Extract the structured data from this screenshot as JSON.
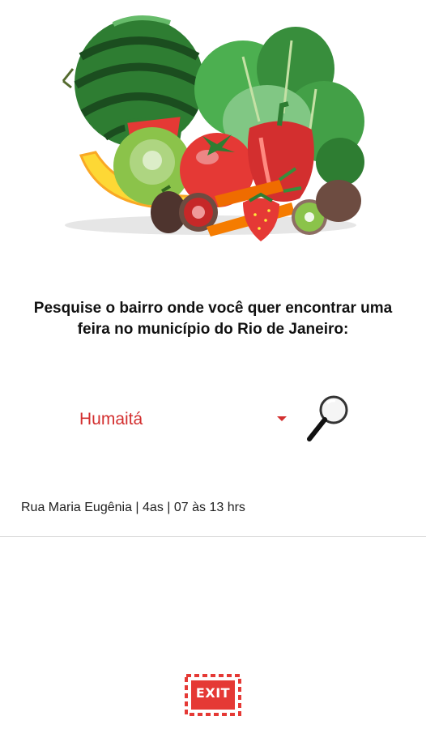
{
  "header": {
    "image": "fruits-and-vegetables-illustration"
  },
  "prompt": {
    "line1": "Pesquise o bairro onde você quer encontrar uma",
    "line2": "feira no município do Rio de Janeiro:"
  },
  "neighborhood_select": {
    "selected": "Humaitá",
    "icon": "dropdown-arrow-icon"
  },
  "search_button": {
    "icon": "magnifying-glass-icon"
  },
  "results": [
    {
      "text": "Rua Maria Eugênia | 4as | 07 às 13 hrs"
    }
  ],
  "exit_button": {
    "label": "EXIT",
    "icon": "exit-sign-icon"
  },
  "colors": {
    "accent": "#d32f2f",
    "text": "#111111",
    "divider": "#d9d9d9"
  }
}
